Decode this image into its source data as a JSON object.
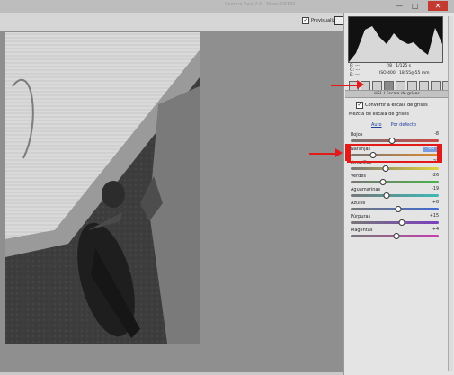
{
  "window": {
    "title": "Camera Raw 7.0 - Nikon D5100",
    "min_glyph": "—",
    "max_glyph": "□",
    "close_glyph": "✕"
  },
  "toolbar": {
    "preview_label": "Previsualizar",
    "preview_checked": "✓"
  },
  "panel": {
    "rgb_labels": [
      "R:",
      "G:",
      "B:"
    ],
    "rgb_values": [
      "---",
      "---",
      "---"
    ],
    "exposure": "f/8",
    "shutter": "1/125 s",
    "iso": "ISO 400",
    "lens": "18-55@55 mm",
    "section_title": "HSL / Escala de grises",
    "convert_label": "Convertir a escala de grises",
    "convert_checked": "✓",
    "mix_title": "Mezcla de escala de grises",
    "tab_auto": "Auto",
    "tab_default": "Por defecto"
  },
  "sliders": [
    {
      "label": "Rojos",
      "value": "-8",
      "level": 0.47,
      "track": "linear-gradient(90deg,#777,#c44)"
    },
    {
      "label": "Naranjas",
      "value": "-50",
      "level": 0.25,
      "track": "linear-gradient(90deg,#777,#e0872c)",
      "editing": true
    },
    {
      "label": "Amarillos",
      "value": "-21",
      "level": 0.4,
      "track": "linear-gradient(90deg,#777,#e3d33b)"
    },
    {
      "label": "Verdes",
      "value": "-26",
      "level": 0.37,
      "track": "linear-gradient(90deg,#777,#4ab34a)"
    },
    {
      "label": "Aguamarinas",
      "value": "-19",
      "level": 0.41,
      "track": "linear-gradient(90deg,#777,#3bb9b6)"
    },
    {
      "label": "Azules",
      "value": "+8",
      "level": 0.54,
      "track": "linear-gradient(90deg,#777,#3f6bd4)"
    },
    {
      "label": "Púrpuras",
      "value": "+15",
      "level": 0.58,
      "track": "linear-gradient(90deg,#777,#7b3fc0)"
    },
    {
      "label": "Magentas",
      "value": "+4",
      "level": 0.52,
      "track": "linear-gradient(90deg,#777,#c43fb0)"
    }
  ],
  "colors": {
    "annotation_red": "#e21a1a",
    "highlight_field": "#7b9ee0"
  }
}
